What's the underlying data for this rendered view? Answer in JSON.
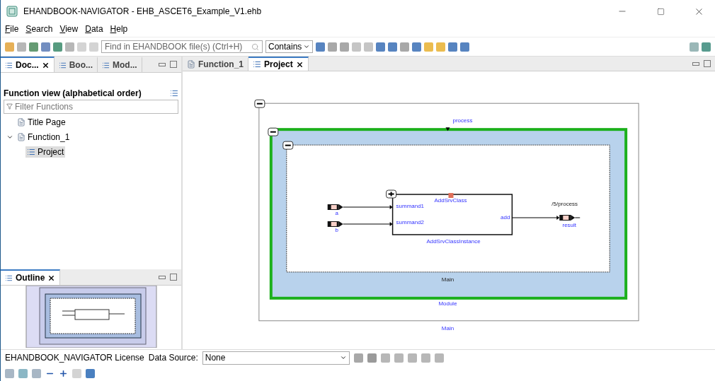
{
  "window": {
    "title": "EHANDBOOK-NAVIGATOR - EHB_ASCET6_Example_V1.ehb"
  },
  "menu": [
    {
      "label": "File"
    },
    {
      "label": "Search"
    },
    {
      "label": "View"
    },
    {
      "label": "Data"
    },
    {
      "label": "Help"
    }
  ],
  "search": {
    "placeholder": "Find in EHANDBOOK file(s) (Ctrl+H)",
    "mode": "Contains"
  },
  "left_tabs": [
    {
      "label": "Doc...",
      "selected": true
    },
    {
      "label": "Boo...",
      "selected": false
    },
    {
      "label": "Mod...",
      "selected": false
    }
  ],
  "function_view": {
    "title": "Function view (alphabetical order)",
    "filter_placeholder": "Filter Functions",
    "tree": [
      {
        "label": "Title Page",
        "kind": "page",
        "selected": false
      },
      {
        "label": "Function_1",
        "kind": "page",
        "selected": false,
        "expanded": true,
        "children": [
          {
            "label": "Project",
            "kind": "model",
            "selected": true
          }
        ]
      }
    ]
  },
  "outline": {
    "title": "Outline"
  },
  "editor_tabs": [
    {
      "label": "Function_1",
      "kind": "page",
      "selected": false
    },
    {
      "label": "Project",
      "kind": "model",
      "selected": true
    }
  ],
  "diagram": {
    "outer_label": "Main",
    "process_label": "process",
    "module_label": "Module",
    "inner_label": "Main",
    "block": {
      "class": "AddSrvClass",
      "instance": "AddSrvClassInstance",
      "inputs": [
        "summand1",
        "summand2"
      ],
      "output": "add"
    },
    "inputs": [
      "a",
      "b"
    ],
    "output": "result",
    "output_path": "/5/process"
  },
  "status_bar": {
    "license": "EHANDBOOK_NAVIGATOR License",
    "data_source_label": "Data Source:",
    "data_source": "None"
  }
}
